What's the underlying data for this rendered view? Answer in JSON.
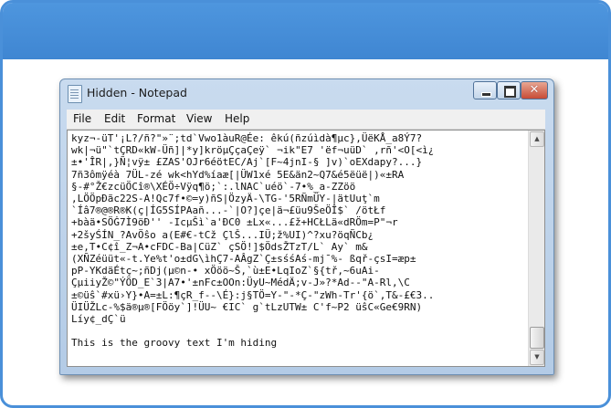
{
  "window": {
    "title": "Hidden - Notepad",
    "close_glyph": "✕",
    "scroll_up_glyph": "▲",
    "scroll_down_glyph": "▼"
  },
  "menu": [
    "File",
    "Edit",
    "Format",
    "View",
    "Help"
  ],
  "editor": {
    "content": "kyz¬-üT'¡L?/ñ?\"»¨;td`Vwo1àuR@Ée: êkú(ñzúìdà¶µc},ÜëKÅ_a8Ý7?\nwk|¬ü\"`tÇRD«kW-Üñ]|*y]kröµÇçaÇeÿ` ¬ik\"E7 'ëf¬uüD` ,rñ'<O[<ì¿\n±•'ÎR|,}Ñ¦vÿ± £ZAS'OJr6éötEC/Aj`[F~4jnΙ-§ ]v)`oEXdapy?...}\n7ñ3ômÿéà 7ÜL-zé wk<hYd%íaæ[|ÜW1xé 5E&än2~Q7&é5ëüë|)«±RA\n§-#°Ž€zcüÖCî®\\XÉÖ÷Vÿq¶ö;`:.lNAC`uéö`-7•%_a-ZZöö\n‚LÖÖpÐãc22S-A!Qc7f•©=y)ñS|ÖzyÄ-\\TG-'5RÑmÜY-|ätUuţ`m\n`Íâ7®@®R®K(ç|ÍG5SÍPAañ...-`|O?]çe|ä¬£üu9ŠeÖÎ$` /ötŁf\n+bàä•SÖĠ7Ì9öÐ'' -IcµŠì`a'ÐC0 ±Lx«...£ž+HCŁLä«dRÖm=P\"¬r\n+2šyŚÍN_?AvÖŝo a(E#€-tCž ÇlŠ...IÜ;ž%UI)^?xu?öqÑCb¿\n±e,T•C¢î_Z¬A•cFDC-Ba|CüZ` çSÖ!]$ÖdsŽTzT/L` Ay` m&\n(XÑZéüüt«-t.Ye%t'o±dG\\ìhÇ7-AÂgZ`Ç±sśśAś-mj¯%- ßqř-çsI=æp±\npP-YKdäÉtç~;ñDj(µ©n-• xÖöö~Š,`ù±E•LqIoZ`§{tř,~6uAi-\nÇµiiyŽ©\"ÝÖD_E`3|A7•'±nFc±OOn:ÜyU~MédÄ;v-J»?*Ad--\"A-Rl,\\C\n±©üŝ`#xü›Y}•A=±L:¶çR_f--\\É}:j§TÖ=Y-\"-*Ç-\"zWh-Tr'{ö`,T&-£€3..\nÜIÜŽLc-%$ä®µ®[FÖöy`]!ÜU~ €IC` g`tLzUTW± C'f~P2 üŝC«Ge€9RN)\nLíy¢_dÇ`ü\n\nThis is the groovy text I'm hiding"
  }
}
